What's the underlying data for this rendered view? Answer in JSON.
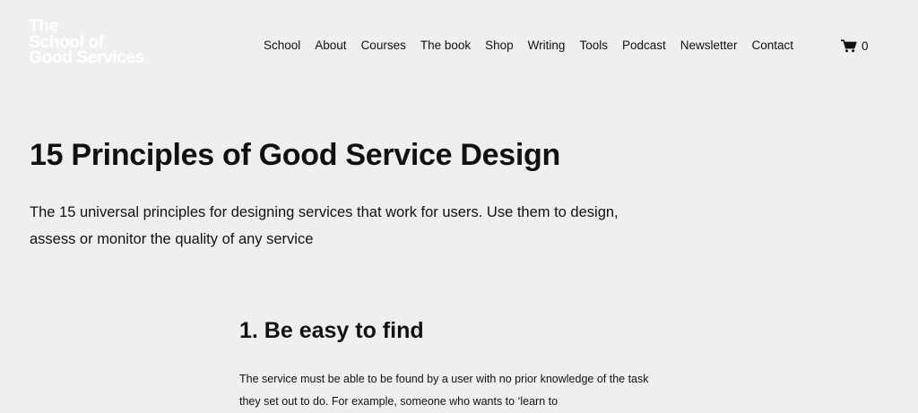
{
  "header": {
    "logo_lines": [
      "The",
      "School of",
      "Good Services"
    ],
    "nav": [
      {
        "label": "School"
      },
      {
        "label": "About"
      },
      {
        "label": "Courses"
      },
      {
        "label": "The book"
      },
      {
        "label": "Shop"
      },
      {
        "label": "Writing"
      },
      {
        "label": "Tools"
      },
      {
        "label": "Podcast"
      },
      {
        "label": "Newsletter"
      },
      {
        "label": "Contact"
      }
    ],
    "cart": {
      "icon": "cart-icon",
      "count": "0"
    }
  },
  "main": {
    "title": "15 Principles of Good Service Design",
    "intro": "The 15 universal principles for designing services that work for users. Use them to design, assess or monitor the quality of any service",
    "sections": [
      {
        "heading": "1. Be easy to find",
        "body": "The service must be able to be found by a user with no prior knowledge of the task they set out to do. For example, someone who wants to ‘learn to"
      }
    ]
  },
  "colors": {
    "background": "#efefee",
    "text": "#111111",
    "logo": "#ffffff"
  }
}
